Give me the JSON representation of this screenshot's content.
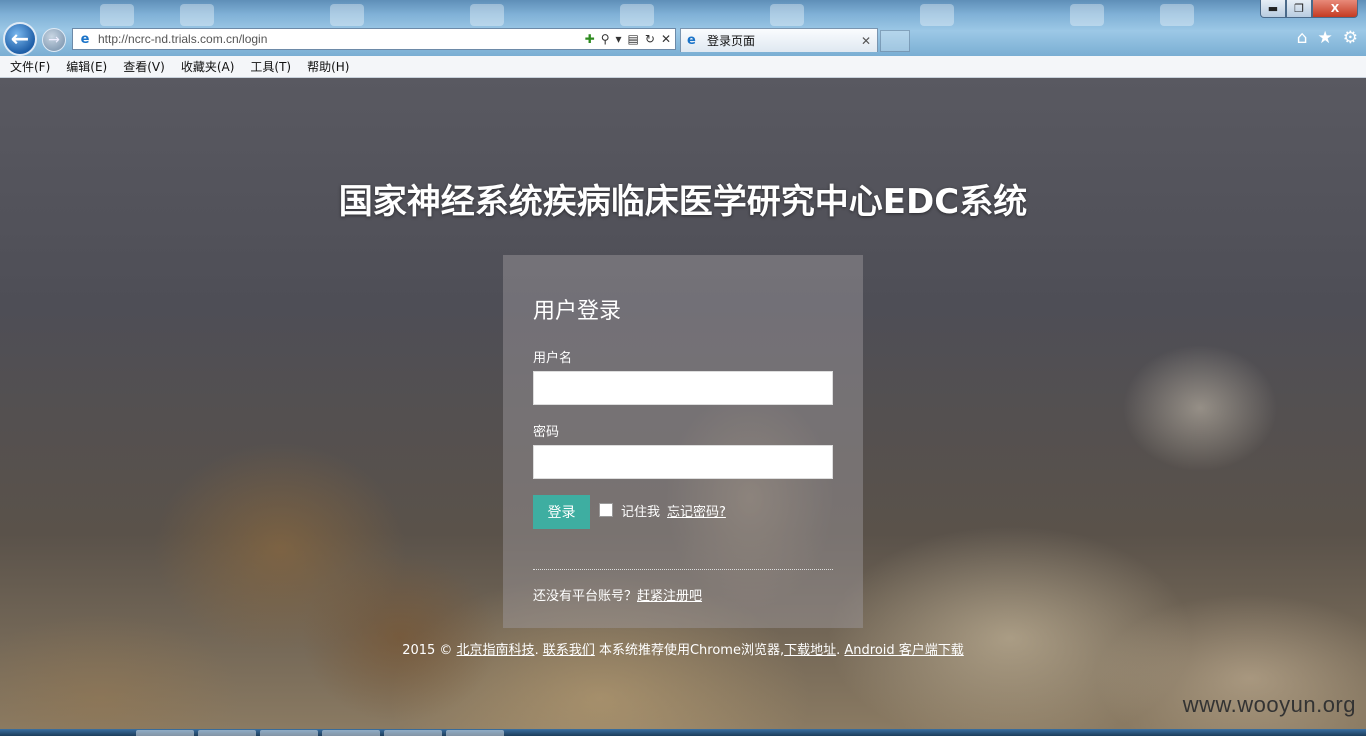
{
  "browser": {
    "address_url": "http://ncrc-nd.trials.com.cn/login",
    "tab_title": "登录页面",
    "window_buttons": {
      "minimize": "▬",
      "restore": "❐",
      "close": "X"
    },
    "menu": [
      "文件(F)",
      "编辑(E)",
      "查看(V)",
      "收藏夹(A)",
      "工具(T)",
      "帮助(H)"
    ]
  },
  "page": {
    "title": "国家神经系统疾病临床医学研究中心EDC系统",
    "login": {
      "heading": "用户登录",
      "username_label": "用户名",
      "username_value": "",
      "password_label": "密码",
      "password_value": "",
      "submit_label": "登录",
      "remember_label": "记住我",
      "forgot_label": "忘记密码?",
      "signup_prompt": "还没有平台账号？",
      "signup_link": "赶紧注册吧"
    },
    "footer": {
      "copyright": "2015 © ",
      "company_link": "北京指南科技",
      "sep1": ". ",
      "contact_link": "联系我们",
      "recommend_text": " 本系统推荐使用Chrome浏览器,",
      "download_link": "下载地址",
      "sep2": ". ",
      "android_link": "Android 客户端下载"
    }
  },
  "watermark": "www.wooyun.org",
  "colors": {
    "button_accent": "#3eaea1",
    "ie_blue": "#1a73c8"
  }
}
